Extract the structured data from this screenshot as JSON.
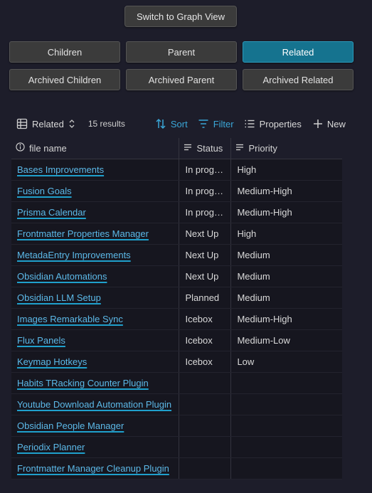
{
  "top": {
    "graph_button": "Switch to Graph View"
  },
  "relations": {
    "buttons": [
      "Children",
      "Parent",
      "Related",
      "Archived Children",
      "Archived Parent",
      "Archived Related"
    ],
    "active": "Related"
  },
  "toolbar": {
    "view_icon": "table-icon",
    "view_label": "Related",
    "count": "15 results",
    "sort": "Sort",
    "filter": "Filter",
    "properties": "Properties",
    "new": "New"
  },
  "columns": {
    "file": "file name",
    "status": "Status",
    "priority": "Priority"
  },
  "rows": [
    {
      "file": "Bases Improvements",
      "status": "In progress",
      "priority": "High"
    },
    {
      "file": "Fusion Goals",
      "status": "In progress",
      "priority": "Medium-High"
    },
    {
      "file": "Prisma Calendar",
      "status": "In progress",
      "priority": "Medium-High"
    },
    {
      "file": "Frontmatter Properties Manager",
      "status": "Next Up",
      "priority": "High"
    },
    {
      "file": "MetadaEntry Improvements",
      "status": "Next Up",
      "priority": "Medium"
    },
    {
      "file": "Obsidian Automations",
      "status": "Next Up",
      "priority": "Medium"
    },
    {
      "file": "Obsidian LLM Setup",
      "status": "Planned",
      "priority": "Medium"
    },
    {
      "file": "Images Remarkable Sync",
      "status": "Icebox",
      "priority": "Medium-High"
    },
    {
      "file": "Flux Panels",
      "status": "Icebox",
      "priority": "Medium-Low"
    },
    {
      "file": "Keymap Hotkeys",
      "status": "Icebox",
      "priority": "Low"
    },
    {
      "file": "Habits TRacking Counter Plugin",
      "status": "",
      "priority": ""
    },
    {
      "file": "Youtube Download Automation Plugin",
      "status": "",
      "priority": ""
    },
    {
      "file": "Obsidian People Manager",
      "status": "",
      "priority": ""
    },
    {
      "file": "Periodix Planner",
      "status": "",
      "priority": ""
    },
    {
      "file": "Frontmatter Manager Cleanup Plugin",
      "status": "",
      "priority": ""
    }
  ],
  "colors": {
    "accent": "#15738f",
    "link": "#5cb9e8",
    "background": "#1d1d2a"
  }
}
